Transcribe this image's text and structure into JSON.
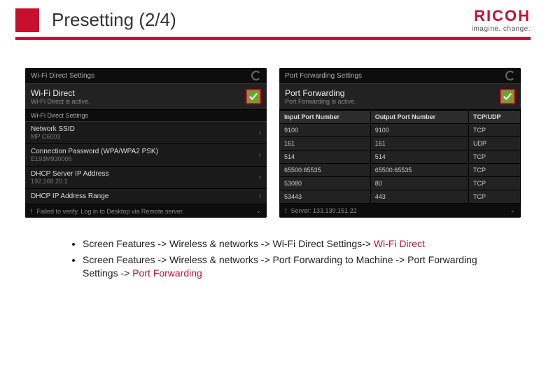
{
  "header": {
    "title": "Presetting (2/4)",
    "brand": "RICOH",
    "tagline": "imagine. change."
  },
  "left_panel": {
    "top_bar": "Wi-Fi Direct Settings",
    "section_title": "Wi-Fi Direct",
    "section_sub": "Wi-Fi Direct is active.",
    "subhead": "Wi-Fi Direct Settings",
    "rows": [
      {
        "label": "Network SSID",
        "value": "MP C6003"
      },
      {
        "label": "Connection Password (WPA/WPA2 PSK)",
        "value": "E193M930006"
      },
      {
        "label": "DHCP Server IP Address",
        "value": "192.168.20.1"
      },
      {
        "label": "DHCP IP Address Range",
        "value": ""
      }
    ],
    "footer": "Failed to verify. Log in to Desktop via Remote server."
  },
  "right_panel": {
    "top_bar": "Port Forwarding Settings",
    "section_title": "Port Forwarding",
    "section_sub": "Port Forwarding is active.",
    "table": {
      "headers": [
        "Input Port Number",
        "Output Port Number",
        "TCP/UDP"
      ],
      "rows": [
        [
          "9100",
          "9100",
          "TCP"
        ],
        [
          "161",
          "161",
          "UDP"
        ],
        [
          "514",
          "514",
          "TCP"
        ],
        [
          "65500:65535",
          "65500:65535",
          "TCP"
        ],
        [
          "53080",
          "80",
          "TCP"
        ],
        [
          "53443",
          "443",
          "TCP"
        ]
      ]
    },
    "footer": "Server: 133.139.151.22"
  },
  "bullets": {
    "b1a": "Screen Features -> Wireless & networks -> Wi-Fi Direct Settings-> ",
    "b1b": "Wi-Fi Direct",
    "b2a": "Screen Features -> Wireless & networks -> Port Forwarding to Machine -> Port Forwarding Settings -> ",
    "b2b": "Port Forwarding"
  }
}
